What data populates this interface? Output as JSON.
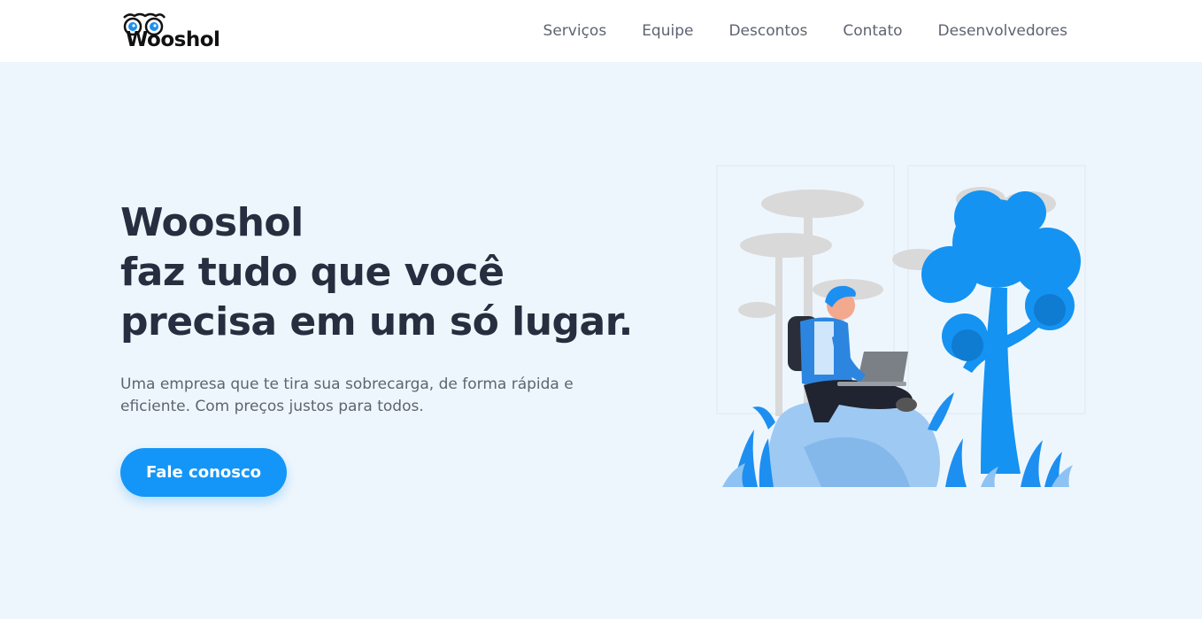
{
  "brand": {
    "logo_text": "Wooshol",
    "logo_icon": "owl-eyes-icon"
  },
  "nav": {
    "items": [
      "Serviços",
      "Equipe",
      "Descontos",
      "Contato",
      "Desenvolvedores"
    ]
  },
  "hero": {
    "title_lines": [
      "Wooshol",
      "faz tudo que você",
      "precisa em um só lugar."
    ],
    "subtitle": "Uma empresa que te tira sua sobrecarga, de forma rápida e eficiente. Com preços justos para todos.",
    "cta_label": "Fale conosco",
    "illustration": "person-with-laptop-in-forest-illustration"
  },
  "colors": {
    "accent": "#1496f8",
    "background": "#eef6fd",
    "heading": "#262e3f",
    "body_text": "#5e6470",
    "nav_bg": "#ffffff"
  }
}
